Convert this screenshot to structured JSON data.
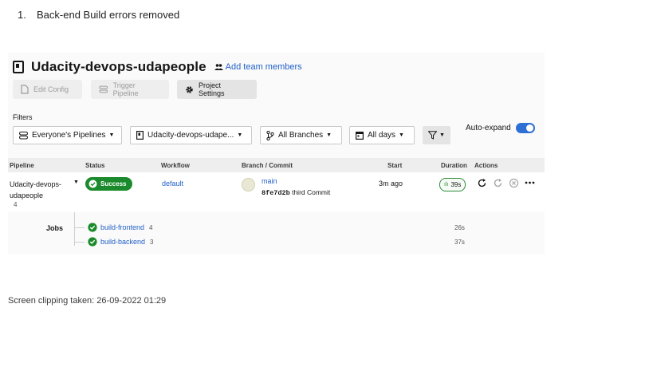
{
  "doc": {
    "list_number": "1.",
    "heading": "Back-end Build errors removed",
    "clip_note": "Screen clipping taken: 26-09-2022 01:29"
  },
  "header": {
    "project_title": "Udacity-devops-udapeople",
    "add_team": "Add team members"
  },
  "toolbar": {
    "edit_config": "Edit Config",
    "trigger_pipeline": "Trigger Pipeline",
    "project_settings": "Project Settings"
  },
  "filters": {
    "label": "Filters",
    "pipelines": "Everyone's Pipelines",
    "project": "Udacity-devops-udape...",
    "branches": "All Branches",
    "days": "All days",
    "auto_expand": "Auto-expand",
    "auto_expand_on": true
  },
  "table": {
    "headers": {
      "pipeline": "Pipeline",
      "status": "Status",
      "workflow": "Workflow",
      "branch_commit": "Branch / Commit",
      "start": "Start",
      "duration": "Duration",
      "actions": "Actions"
    },
    "row": {
      "pipeline_line1": "Udacity-devops-",
      "pipeline_line2": "udapeople",
      "pipeline_number": "4",
      "status": "Success",
      "workflow": "default",
      "branch": "main",
      "commit_hash": "8fe7d2b",
      "commit_message": "third Commit",
      "start": "3m ago",
      "duration": "39s"
    },
    "jobs_label": "Jobs",
    "jobs": [
      {
        "name": "build-frontend",
        "number": "4",
        "duration": "26s"
      },
      {
        "name": "build-backend",
        "number": "3",
        "duration": "37s"
      }
    ]
  },
  "colors": {
    "success": "#1b8a2c",
    "link": "#2161c7",
    "toggle": "#2e6fd3"
  }
}
